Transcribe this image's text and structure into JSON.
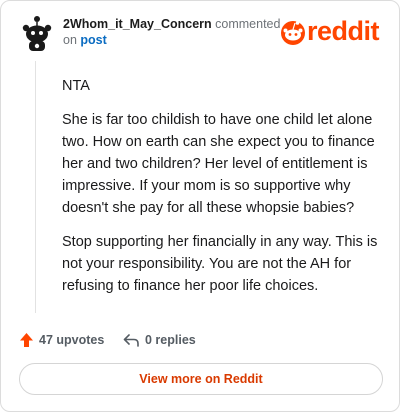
{
  "header": {
    "author": "2Whom_it_May_Concern",
    "action": "commented",
    "on": "on",
    "post_link": "post",
    "logo_text": "reddit"
  },
  "comment": {
    "paragraphs": [
      "NTA",
      "She is far too childish to have one child let alone two. How on earth can she expect you to finance her and two children? Her level of entitlement is impressive. If your mom is so supportive why doesn't she pay for all these whopsie babies?",
      "Stop supporting her financially in any way. This is not your responsibility. You are not the AH for refusing to finance her poor life choices."
    ]
  },
  "footer": {
    "upvotes": "47 upvotes",
    "replies": "0 replies"
  },
  "view_more_label": "View more on Reddit",
  "colors": {
    "brand": "#ff4500",
    "link": "#0a6cc2",
    "cta_text": "#d93a00"
  },
  "icons": [
    "snoo-avatar-icon",
    "reddit-logo-icon",
    "upvote-arrow-icon",
    "reply-arrow-icon"
  ]
}
